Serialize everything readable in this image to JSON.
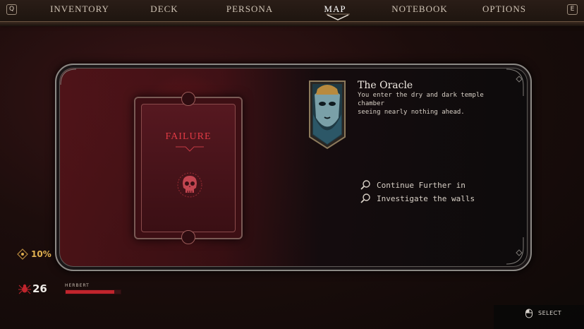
{
  "nav": {
    "left_key": "Q",
    "right_key": "E",
    "tabs": [
      {
        "label": "INVENTORY",
        "active": false
      },
      {
        "label": "DECK",
        "active": false
      },
      {
        "label": "PERSONA",
        "active": false
      },
      {
        "label": "MAP",
        "active": true
      },
      {
        "label": "NOTEBOOK",
        "active": false
      },
      {
        "label": "OPTIONS",
        "active": false
      }
    ]
  },
  "card": {
    "title": "FAILURE",
    "icon": "skull-icon",
    "accent_color": "#e03a44"
  },
  "encounter": {
    "portrait_icon": "oracle-mask-icon",
    "title": "The Oracle",
    "description_line1": "You enter the dry and dark temple chamber",
    "description_line2": "seeing nearly nothing ahead.",
    "choices": [
      {
        "label": "Continue Further in",
        "icon": "magnifier-icon"
      },
      {
        "label": "Investigate the walls",
        "icon": "magnifier-icon"
      }
    ]
  },
  "hud": {
    "percent": "10%",
    "percent_icon": "compass-icon",
    "character": {
      "level": "26",
      "name": "HERBERT",
      "health_fraction": 0.88,
      "icon": "spider-icon"
    },
    "select_label": "SELECT",
    "select_icon": "mouse-icon"
  }
}
